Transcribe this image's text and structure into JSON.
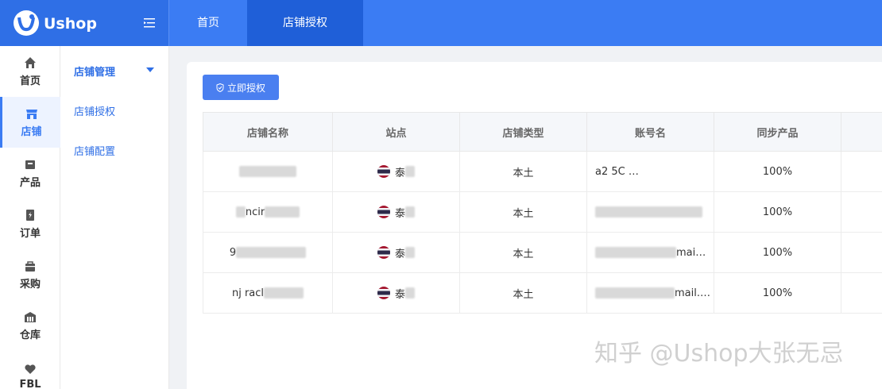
{
  "app": {
    "name": "Ushop"
  },
  "top_nav": {
    "tabs": [
      {
        "label": "首页"
      },
      {
        "label": "店铺授权"
      }
    ]
  },
  "rail": {
    "items": [
      {
        "label": "首页",
        "icon": "home-icon"
      },
      {
        "label": "店铺",
        "icon": "store-icon"
      },
      {
        "label": "产品",
        "icon": "box-icon"
      },
      {
        "label": "订单",
        "icon": "order-icon"
      },
      {
        "label": "采购",
        "icon": "bag-icon"
      },
      {
        "label": "仓库",
        "icon": "warehouse-icon"
      },
      {
        "label": "FBL",
        "icon": "heart-icon"
      }
    ]
  },
  "submenu": {
    "header": "店铺管理",
    "items": [
      {
        "label": "店铺授权"
      },
      {
        "label": "店铺配置"
      }
    ]
  },
  "toolbar": {
    "authorize_label": "立即授权"
  },
  "table": {
    "columns": [
      "店铺名称",
      "站点",
      "店铺类型",
      "账号名",
      "同步产品"
    ],
    "rows": [
      {
        "store_name": "",
        "site": "泰",
        "store_type": "本土",
        "account": "a2 5C …",
        "sync": "100%"
      },
      {
        "store_name": "ncir",
        "site": "泰",
        "store_type": "本土",
        "account": "",
        "sync": "100%"
      },
      {
        "store_name": "9",
        "site": "泰",
        "store_type": "本土",
        "account": "mai…",
        "sync": "100%"
      },
      {
        "store_name": "nj racl",
        "site": "泰",
        "store_type": "本土",
        "account": "mail.…",
        "sync": "100%"
      }
    ]
  },
  "watermark": "知乎 @Ushop大张无忌",
  "colors": {
    "primary": "#3b7cf3",
    "accent": "#2f6fe6"
  }
}
